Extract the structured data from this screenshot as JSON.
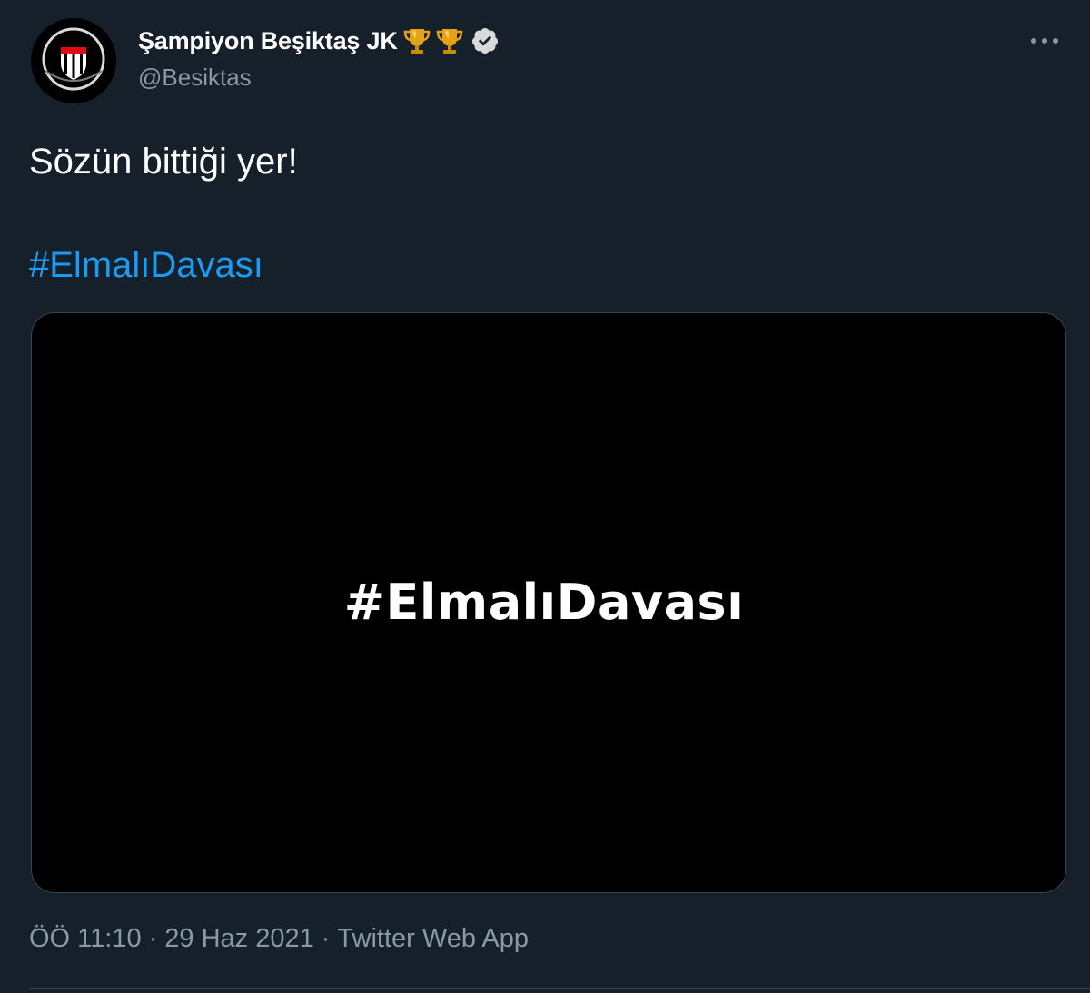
{
  "tweet": {
    "author": {
      "display_name": "Şampiyon Beşiktaş JK",
      "handle": "@Besiktas",
      "avatar_icon": "besiktas-crest",
      "badges": [
        "trophy-icon",
        "trophy-icon"
      ],
      "verified": true
    },
    "text": "Sözün bittiği yer!",
    "hashtag": "#ElmalıDavası",
    "media": {
      "overlay_text": "#ElmalıDavası",
      "background": "#000000"
    },
    "meta": {
      "time": "ÖÖ 11:10",
      "date": "29 Haz 2021",
      "source": "Twitter Web App",
      "separator": "·"
    }
  },
  "colors": {
    "background": "#15202b",
    "text_primary": "#ffffff",
    "text_secondary": "#8b98a5",
    "link": "#1d9bf0",
    "border": "#38444d",
    "trophy": "#e6a317"
  }
}
